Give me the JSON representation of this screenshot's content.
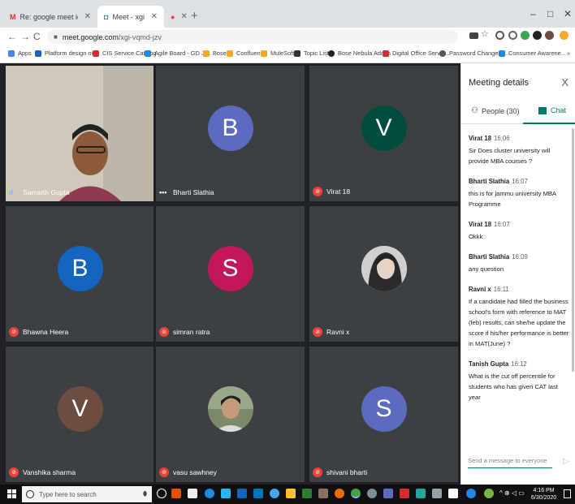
{
  "browser": {
    "tabs": [
      {
        "title": "Re: google meet id - amitc.jmu@",
        "favicon": "gmail-icon",
        "active": false
      },
      {
        "title": "Meet - xgi-vqmd-jzv",
        "favicon": "meet-icon",
        "active": true
      },
      {
        "title": "",
        "favicon": "record-icon",
        "active": false
      }
    ],
    "new_tab": "+",
    "window_controls": [
      "–",
      "□",
      "✕"
    ],
    "url_host": "meet.google.com",
    "url_path": "/xgi-vqmd-jzv",
    "bookmarks": [
      {
        "label": "Apps",
        "color": "#4285f4"
      },
      {
        "label": "Platform design ov...",
        "color": "#1565c0"
      },
      {
        "label": "CIS Service Catalog",
        "color": "#d32f2f"
      },
      {
        "label": "Agile Board - GD JI...",
        "color": "#1e88e5"
      },
      {
        "label": "Bose",
        "color": "#f9a825"
      },
      {
        "label": "Confluent",
        "color": "#f9a825"
      },
      {
        "label": "MuleSoft",
        "color": "#f9a825"
      },
      {
        "label": "Topic List",
        "color": "#333333"
      },
      {
        "label": "Bose Nebula Admin",
        "color": "#222222"
      },
      {
        "label": "Digital Office Servic...",
        "color": "#d32f2f"
      },
      {
        "label": "Password Change U...",
        "color": "#555555"
      },
      {
        "label": "Consumer Awarene...",
        "color": "#1e88e5"
      }
    ],
    "bookmarks_more": "»"
  },
  "meet": {
    "participants": [
      {
        "name": "Samarth Gupta",
        "initial": "",
        "avatar_color": "",
        "status": "speaking"
      },
      {
        "name": "Bharti Slathia",
        "initial": "B",
        "avatar_color": "#5c6bc0",
        "status": "dots"
      },
      {
        "name": "Virat 18",
        "initial": "V",
        "avatar_color": "#004d40",
        "status": "muted"
      },
      {
        "name": "Bhawna Heera",
        "initial": "B",
        "avatar_color": "#1565c0",
        "status": "muted"
      },
      {
        "name": "simran ratra",
        "initial": "S",
        "avatar_color": "#c2185b",
        "status": "muted"
      },
      {
        "name": "Ravni x",
        "initial": "",
        "avatar_color": "",
        "status": "muted"
      },
      {
        "name": "Vanshika sharma",
        "initial": "V",
        "avatar_color": "#6d4c41",
        "status": "muted"
      },
      {
        "name": "vasu sawhney",
        "initial": "",
        "avatar_color": "",
        "status": "muted"
      },
      {
        "name": "shivani bharti",
        "initial": "S",
        "avatar_color": "#5c6bc0",
        "status": "muted"
      }
    ]
  },
  "panel": {
    "title": "Meeting details",
    "close": "X",
    "people_tab": "People (30)",
    "chat_tab": "Chat",
    "messages": [
      {
        "sender": "Virat 18",
        "time": "16:06",
        "text": "Sir Does cluster university will provide MBA courses ?"
      },
      {
        "sender": "Bharti Slathia",
        "time": "16:07",
        "text": "this is for jammu university MBA Programme"
      },
      {
        "sender": "Virat 18",
        "time": "16:07",
        "text": "Okkk"
      },
      {
        "sender": "Bharti Slathia",
        "time": "16:09",
        "text": "any question"
      },
      {
        "sender": "Ravni x",
        "time": "16:11",
        "text": "If a candidate had filled the business school's form with reference to MAT (feb) results, can she/he update the score if his/her performance is better in MAT(June) ?"
      },
      {
        "sender": "Tanish Gupta",
        "time": "16:12",
        "text": "What is the cut off percentile for students who has given CAT last year"
      }
    ],
    "compose_placeholder": "Send a message to everyone",
    "accent": "#00796b"
  },
  "taskbar": {
    "search_placeholder": "Type here to search",
    "time": "4:16 PM",
    "date": "6/30/2020"
  }
}
